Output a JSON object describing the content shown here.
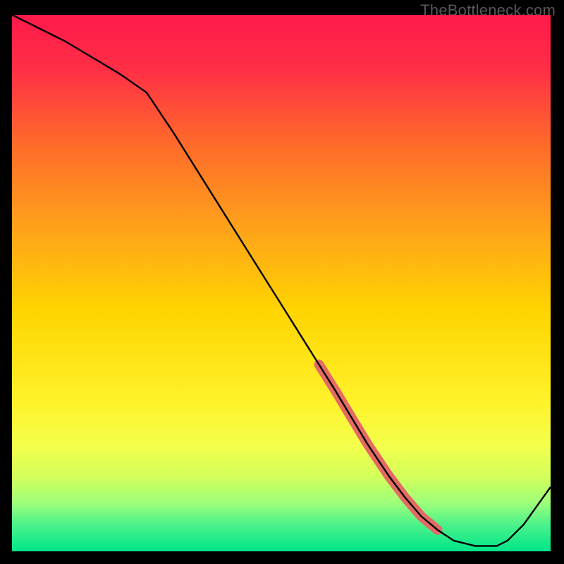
{
  "watermark": "TheBottleneck.com",
  "chart_data": {
    "type": "line",
    "title": "",
    "xlabel": "",
    "ylabel": "",
    "xlim": [
      0,
      100
    ],
    "ylim": [
      0,
      100
    ],
    "x": [
      0,
      5,
      10,
      15,
      20,
      25,
      30,
      35,
      40,
      45,
      50,
      55,
      60,
      63,
      66,
      70,
      73,
      76,
      79,
      82,
      86,
      90,
      92,
      95,
      100
    ],
    "values": [
      100,
      97.5,
      95,
      92,
      89,
      85.5,
      78,
      70,
      62,
      54,
      46,
      38,
      30,
      25,
      20,
      14,
      10,
      6.5,
      4,
      2,
      1,
      1,
      2,
      5,
      12
    ],
    "highlight_region": {
      "x_start": 57,
      "x_end": 79,
      "note": "thicker coral-colored segment of the curve indicating a highlighted band"
    },
    "background_gradient": {
      "top_color": "#ff1a4a",
      "mid_colors": [
        "#ff6a2a",
        "#ffd400",
        "#f4ff4a",
        "#9dff7a"
      ],
      "bottom_color": "#00e58a",
      "note": "vertical red-to-green spectrum"
    }
  }
}
